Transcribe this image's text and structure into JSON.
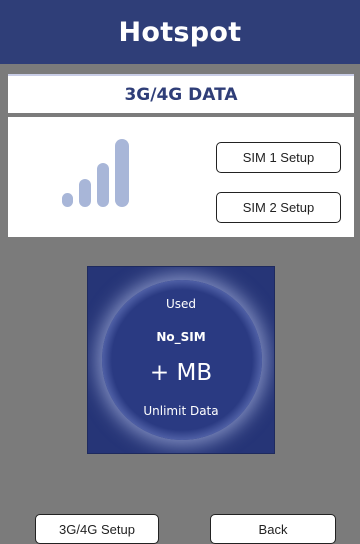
{
  "header": {
    "title": "Hotspot"
  },
  "card": {
    "title": "3G/4G DATA",
    "signal_icon": "signal-bars-icon",
    "signal_color": "#a8b6d8",
    "sim1_label": "SIM 1 Setup",
    "sim2_label": "SIM 2 Setup"
  },
  "usage": {
    "used_label": "Used",
    "sim_status": "No_SIM",
    "amount": "+ MB",
    "plan": "Unlimit Data"
  },
  "footer": {
    "setup_label": "3G/4G Setup",
    "back_label": "Back"
  },
  "colors": {
    "header_bg": "#2f3e78",
    "page_bg": "#7b7b7b",
    "panel_bg": "#263577"
  }
}
